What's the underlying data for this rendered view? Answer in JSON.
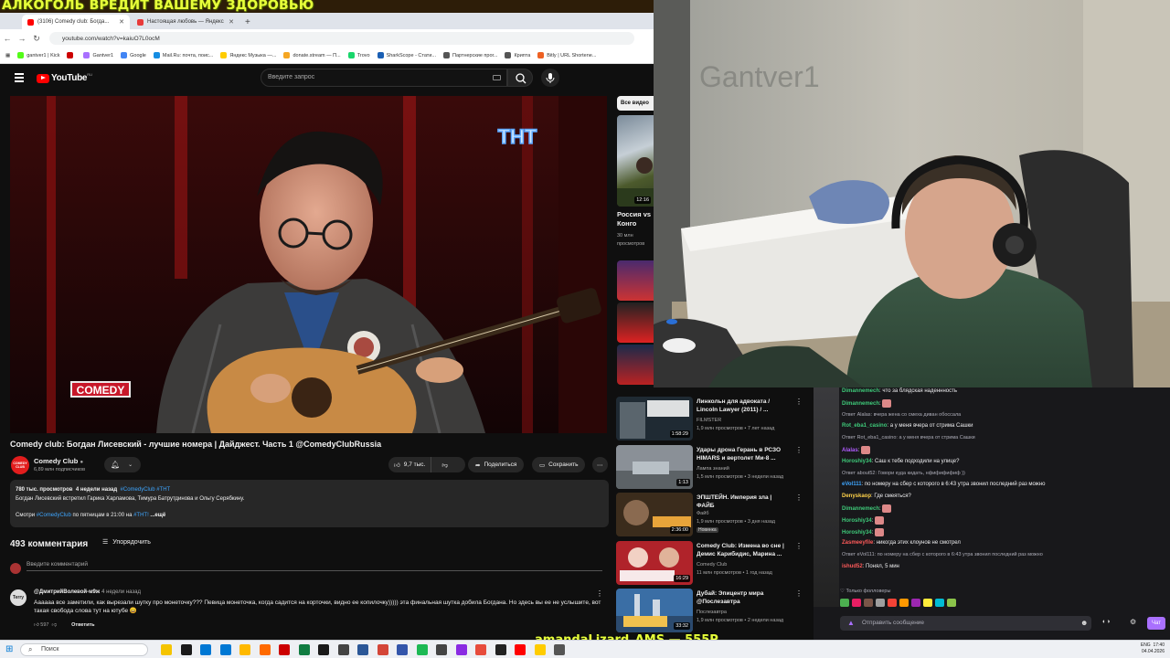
{
  "banner": "АЛКОГОЛЬ ВРЕДИТ ВАШЕМУ ЗДОРОВЬЮ",
  "browser": {
    "tabs": [
      {
        "label": "(3106) Comedy club: Богда...",
        "active": true,
        "color": "#ff0000"
      },
      {
        "label": "Настоящая любовь — Яндекс",
        "active": false,
        "color": "#e83a3a"
      }
    ],
    "new_tab": "+",
    "url": "youtube.com/watch?v=kaiuO7L0ocM",
    "bookmarks": [
      {
        "label": "gantver1 | Kick",
        "color": "#53fc18"
      },
      {
        "label": "",
        "color": "#c00"
      },
      {
        "label": "Gantver1",
        "color": "#a970ff"
      },
      {
        "label": "Google",
        "color": "#4285f4"
      },
      {
        "label": "Mail.Ru: почта, поис...",
        "color": "#168de2"
      },
      {
        "label": "Яндекс Музыка —...",
        "color": "#ffcc00"
      },
      {
        "label": "donate.stream — П...",
        "color": "#f5a623"
      },
      {
        "label": "Trovo",
        "color": "#19d66b"
      },
      {
        "label": "SharkScope - Стати...",
        "color": "#1a5fb4"
      },
      {
        "label": "Партнерские прог...",
        "color": "#555"
      },
      {
        "label": "Крипта",
        "color": "#555"
      },
      {
        "label": "Bitly | URL Shortene...",
        "color": "#ee6123"
      }
    ]
  },
  "youtube": {
    "logo": "YouTube",
    "logo_region": "RU",
    "search_placeholder": "Введите запрос",
    "video_channel_watermark": "COMEDY",
    "video_network_watermark": "ТНТ",
    "title": "Comedy club: Богдан Лисевский - лучшие номера | Дайджест. Часть 1 @ComedyClubRussia",
    "channel": {
      "name": "Comedy Club",
      "subs": "6,89 млн подписчиков",
      "avatar_text": "COMEDY CLUB"
    },
    "likes": "9,7 тыс.",
    "share": "Поделиться",
    "save": "Сохранить",
    "description": {
      "views": "780 тыс. просмотров",
      "ago": "4 недели назад",
      "tags": "#ComedyClub #ТНТ",
      "line1": "Богдан Лисевский встретил Гарика Харламова, Тимура Батрутдинова и Ольгу Серябкину.",
      "line2_pre": "Смотри",
      "line2_tag": "#ComedyClub",
      "line2_mid": "по пятницам в 21:00 на",
      "line2_tag2": "#ТНТ!",
      "more": "...ещё"
    },
    "comments_count": "493 комментария",
    "sort": "Упорядочить",
    "add_comment": "Введите комментарий",
    "comment": {
      "user": "@ДмитрийВолевой-м9ж",
      "ago": "4 недели назад",
      "avatar": "Terry",
      "text": "Аааааа все заметили, как вырезали шутку про монеточку??? Певица монеточка, когда садится на корточки, видно ее копилочку))))) эта финальная шутка добила Богдана. Но здесь вы ее не услышите, вот такая свобода слова тут на ютубе 😄",
      "likes": "597",
      "reply": "Ответить"
    },
    "side": {
      "chip": "Все видео",
      "first_title": "Россия vs Конго",
      "first_meta1": "30 млн",
      "first_meta2": "просмотров",
      "first_duration": "12:16"
    },
    "recs": [
      {
        "title": "Линкольн для адвоката / Lincoln Lawyer (2011) / ...",
        "channel": "FILMSTER",
        "meta": "1,9 млн просмотров • 7 лет назад",
        "duration": "1:58:29",
        "thumb": "#1f2a33",
        "accent": "#c8d3da",
        "label": "ЛИНКОЛЬН ДЛЯ АДВОКАТА"
      },
      {
        "title": "Удары дрона Герань в РСЗО HIMARS и вертолет Ми-8 ...",
        "channel": "Лампа знаний",
        "meta": "1,5 млн просмотров • 3 недели назад",
        "duration": "1:13",
        "thumb": "#8a9097",
        "accent": "#b8c0c6",
        "label": ""
      },
      {
        "title": "ЭПШТЕЙН. Империя зла | ФАЙБ",
        "channel": "Файб",
        "meta": "1,9 млн просмотров • 3 дня назад",
        "badge": "Новинка",
        "duration": "2:36:00",
        "thumb": "#3b2c1c",
        "accent": "#e8a43a",
        "label": "ЭПШТЕЙН"
      },
      {
        "title": "Comedy Club: Измена во сне | Демис Карибидис, Марина ...",
        "channel": "Comedy Club",
        "meta": "11 млн просмотров • 1 год назад",
        "duration": "16:29",
        "thumb": "#b0232a",
        "accent": "#f2d1c4",
        "label": "ИЗМЕНА ВО СНЕ"
      },
      {
        "title": "Дубай: Эпицентр мира @Послезавтра",
        "channel": "Послезавтра",
        "meta": "1,9 млн просмотров • 2 недели назад",
        "duration": "33:32",
        "thumb": "#3a6ea5",
        "accent": "#f2c14e",
        "label": "ДУБАЙ"
      }
    ]
  },
  "webcam": {
    "wall_text": "Gantver1"
  },
  "chat": {
    "lines": [
      {
        "user": "Dimannemech",
        "color": "#3ec979",
        "text": "что за блядская наденнность"
      },
      {
        "user": "Dimannemech",
        "color": "#3ec979",
        "text": ""
      },
      {
        "reply": "Ответ Alalas: вчера жена со смеха диван обоссала"
      },
      {
        "user": "Rot_eba1_casino",
        "color": "#3ec979",
        "text": "а у меня вчера от стрима Сашки"
      },
      {
        "reply": "Ответ Rot_eba1_casino: а у меня вчера от стрима Сашки"
      },
      {
        "user": "Alalas",
        "color": "#b05cff",
        "text": ""
      },
      {
        "user": "Horoshiy34",
        "color": "#3ec979",
        "text": "Саш к тебе подходили на улице?"
      },
      {
        "reply": "Ответ about52: Говори куда кидать, нфифифифиф ))"
      },
      {
        "user": "eVol111",
        "color": "#3ea6ff",
        "text": "по номеру на сбер с которого в 6:43 утра звонил последний раз можно"
      },
      {
        "user": "Denyskaop",
        "color": "#ffd24a",
        "text": "Где смеяться?"
      },
      {
        "user": "Dimannemech",
        "color": "#3ec979",
        "text": ""
      },
      {
        "user": "Horoshiy34",
        "color": "#3ec979",
        "text": ""
      },
      {
        "user": "Horoshiy34",
        "color": "#3ec979",
        "text": ""
      },
      {
        "user": "Zasmeeyfile",
        "color": "#ff5a5a",
        "text": "никогда этих клоунов не смотрел"
      },
      {
        "reply": "Ответ eVol111: по номеру на сбер с которого в 6:43 утра звонил последний раз можно"
      },
      {
        "user": "ishud52",
        "color": "#ff5a5a",
        "text": "Понял, 5 мин"
      }
    ],
    "followers_only": "Только фолловеры",
    "input_placeholder": "Отправить сообщение",
    "send": "Чат"
  },
  "overlay_nick": "amandaLizard_AMS — 555P",
  "taskbar": {
    "search": "Поиск",
    "time": "17:40",
    "date": "04.04.2026",
    "lang": "ENG",
    "icons": [
      "#f5c400",
      "#1a1a1a",
      "#0078d4",
      "#0078d4",
      "#ffb900",
      "#ff6a00",
      "#c00",
      "#107c41",
      "#1a1a1a",
      "#444",
      "#2b5797",
      "#d44638",
      "#35a",
      "#1db954",
      "#444",
      "#8a2be2",
      "#e74c3c",
      "#222",
      "#ff0000",
      "#fc0",
      "#555"
    ]
  }
}
